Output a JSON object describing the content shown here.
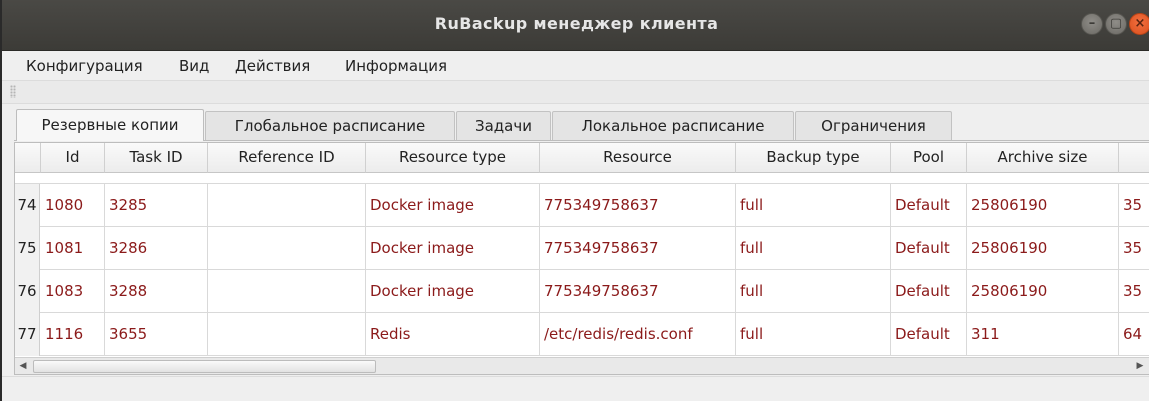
{
  "window": {
    "title": "RuBackup менеджер клиента",
    "controls": {
      "minimize": "–",
      "maximize": "▢",
      "close": "×"
    }
  },
  "menu": {
    "items": [
      "Конфигурация",
      "Вид",
      "Действия",
      "Информация"
    ]
  },
  "tabs": [
    {
      "label": "Резервные копии",
      "active": true
    },
    {
      "label": "Глобальное расписание",
      "active": false
    },
    {
      "label": "Задачи",
      "active": false
    },
    {
      "label": "Локальное расписание",
      "active": false
    },
    {
      "label": "Ограничения",
      "active": false
    }
  ],
  "table": {
    "columns": [
      "Id",
      "Task ID",
      "Reference ID",
      "Resource type",
      "Resource",
      "Backup type",
      "Pool",
      "Archive size"
    ],
    "rows": [
      {
        "num": "74",
        "cells": [
          "1080",
          "3285",
          "",
          "Docker image",
          "775349758637",
          "full",
          "Default",
          "25806190",
          "35"
        ]
      },
      {
        "num": "75",
        "cells": [
          "1081",
          "3286",
          "",
          "Docker image",
          "775349758637",
          "full",
          "Default",
          "25806190",
          "35"
        ]
      },
      {
        "num": "76",
        "cells": [
          "1083",
          "3288",
          "",
          "Docker image",
          "775349758637",
          "full",
          "Default",
          "25806190",
          "35"
        ]
      },
      {
        "num": "77",
        "cells": [
          "1116",
          "3655",
          "",
          "Redis",
          "/etc/redis/redis.conf",
          "full",
          "Default",
          "311",
          "64"
        ]
      }
    ],
    "text_color": "#8b1a1a"
  },
  "scrollbar": {
    "left_arrow": "◀",
    "right_arrow": "▶"
  }
}
